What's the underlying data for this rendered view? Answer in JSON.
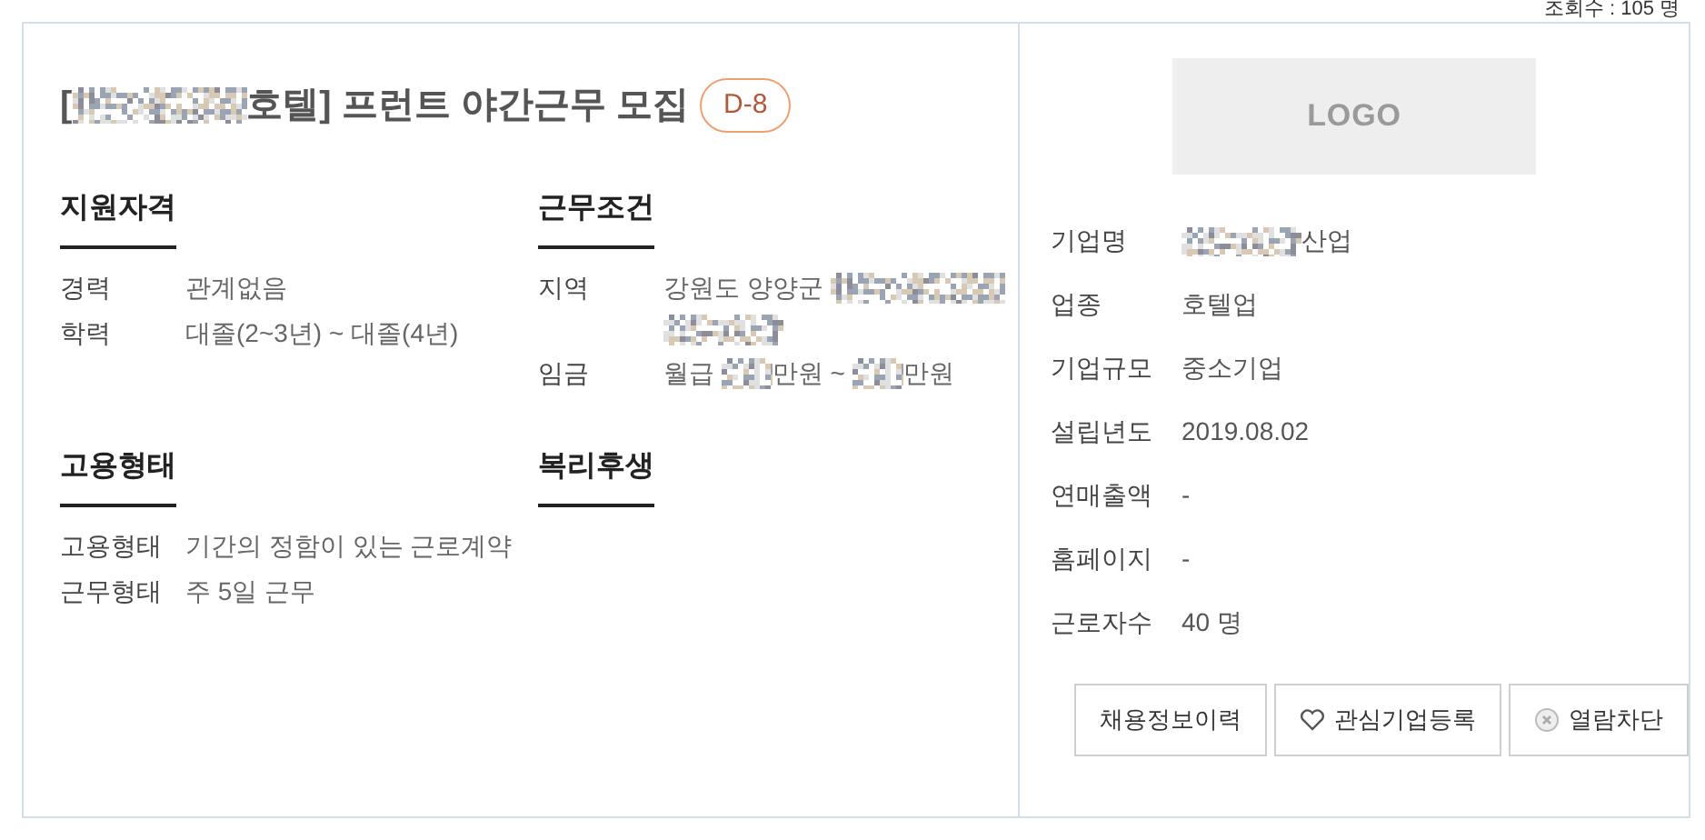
{
  "view_count": "조회수 : 105 명",
  "title": {
    "segments": [
      {
        "kind": "text",
        "text": "["
      },
      {
        "kind": "redacted_long"
      },
      {
        "kind": "text",
        "text": "호텔] 프런트 야간근무 모집"
      }
    ],
    "badge": "D-8"
  },
  "sections": [
    {
      "heading": "지원자격",
      "rows": [
        {
          "label": "경력",
          "lines": [
            [
              {
                "kind": "text",
                "text": "관계없음"
              }
            ]
          ]
        },
        {
          "label": "학력",
          "lines": [
            [
              {
                "kind": "text",
                "text": "대졸(2~3년) ~ 대졸(4년)"
              }
            ]
          ]
        }
      ]
    },
    {
      "heading": "근무조건",
      "rows": [
        {
          "label": "지역",
          "lines": [
            [
              {
                "kind": "text",
                "text": "강원도 양양군 "
              },
              {
                "kind": "redacted_long"
              }
            ],
            [
              {
                "kind": "redacted_medium"
              }
            ]
          ]
        },
        {
          "label": "임금",
          "lines": [
            [
              {
                "kind": "text",
                "text": "월급 "
              },
              {
                "kind": "redacted_short"
              },
              {
                "kind": "text",
                "text": "만원 ~ "
              },
              {
                "kind": "redacted_short"
              },
              {
                "kind": "text",
                "text": "만원"
              }
            ]
          ]
        }
      ]
    },
    {
      "heading": "고용형태",
      "rows": [
        {
          "label": "고용형태",
          "lines": [
            [
              {
                "kind": "text",
                "text": "기간의 정함이 있는 근로계약"
              }
            ]
          ]
        },
        {
          "label": "근무형태",
          "lines": [
            [
              {
                "kind": "text",
                "text": "주 5일 근무"
              }
            ]
          ]
        }
      ]
    },
    {
      "heading": "복리후생"
    }
  ],
  "company": {
    "logo": "LOGO",
    "rows": [
      {
        "label": "기업명",
        "value": [
          {
            "kind": "redacted_medium"
          },
          {
            "kind": "text",
            "text": "산업"
          }
        ]
      },
      {
        "label": "업종",
        "value": [
          {
            "kind": "text",
            "text": "호텔업"
          }
        ]
      },
      {
        "label": "기업규모",
        "value": [
          {
            "kind": "text",
            "text": "중소기업"
          }
        ]
      },
      {
        "label": "설립년도",
        "value": [
          {
            "kind": "text",
            "text": "2019.08.02"
          }
        ]
      },
      {
        "label": "연매출액",
        "value": [
          {
            "kind": "text",
            "text": "-"
          }
        ]
      },
      {
        "label": "홈페이지",
        "value": [
          {
            "kind": "text",
            "text": "-"
          }
        ]
      },
      {
        "label": "근로자수",
        "value": [
          {
            "kind": "text",
            "text": "40 명"
          }
        ]
      }
    ]
  },
  "buttons": [
    {
      "label": "채용정보이력",
      "kind": "plain"
    },
    {
      "label": "관심기업등록",
      "kind": "heart"
    },
    {
      "label": "열람차단",
      "kind": "block"
    }
  ]
}
